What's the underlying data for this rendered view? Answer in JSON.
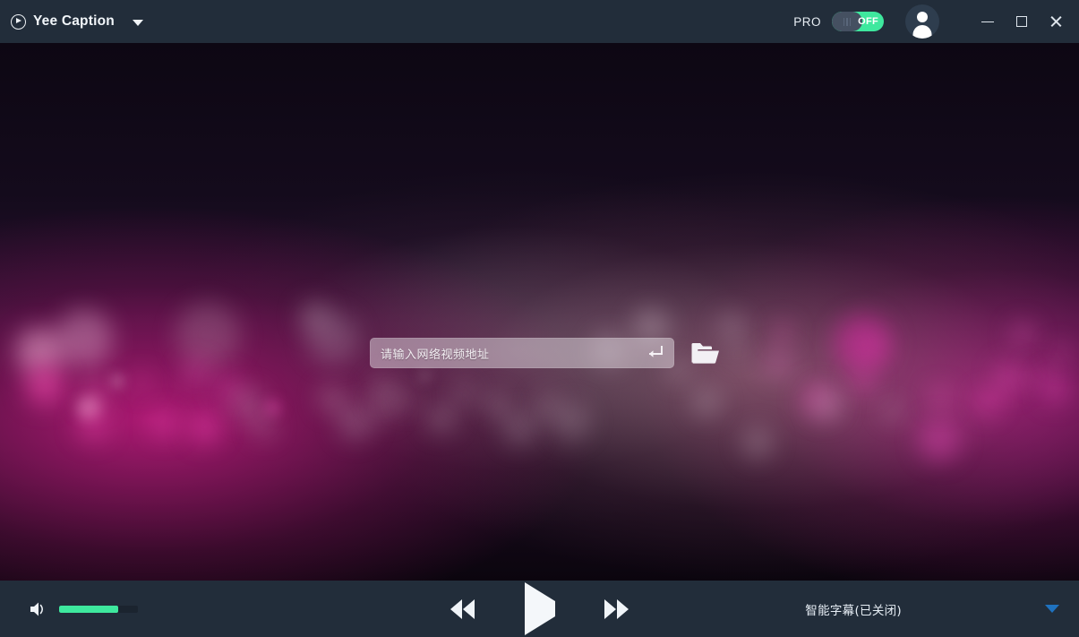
{
  "window": {
    "title": "Yee Caption",
    "brand_icon": "play-circle-icon",
    "brand_caret_icon": "chevron-down-icon"
  },
  "titlebar": {
    "pro_label": "PRO",
    "pro_toggle_state": "OFF",
    "pro_toggle_on_color": "#3ee89e",
    "pro_toggle_knob_color": "#455061",
    "avatar_icon": "user-avatar-icon",
    "minimize_icon": "minimize-icon",
    "maximize_icon": "maximize-icon",
    "close_icon": "close-icon",
    "background_color": "#222d3a",
    "title_color": "#f2f6fa"
  },
  "stage": {
    "media_description": "magenta purple bokeh light background",
    "input": {
      "placeholder": "请输入网络视频地址",
      "value": "",
      "submit_icon": "enter-return-icon"
    },
    "open_folder_icon": "open-folder-icon"
  },
  "controlbar": {
    "background_color": "#222d3a",
    "volume": {
      "icon": "volume-speaker-icon",
      "level_percent": 75,
      "fill_color": "#3ee89e",
      "track_color": "#1b242f"
    },
    "transport": {
      "rewind_label": "rewind-icon",
      "play_label": "play-icon",
      "forward_label": "fast-forward-icon"
    },
    "subtitle": {
      "label": "智能字幕(已关闭)",
      "caret_icon": "chevron-down-icon",
      "caret_color": "#1f72bf"
    }
  }
}
